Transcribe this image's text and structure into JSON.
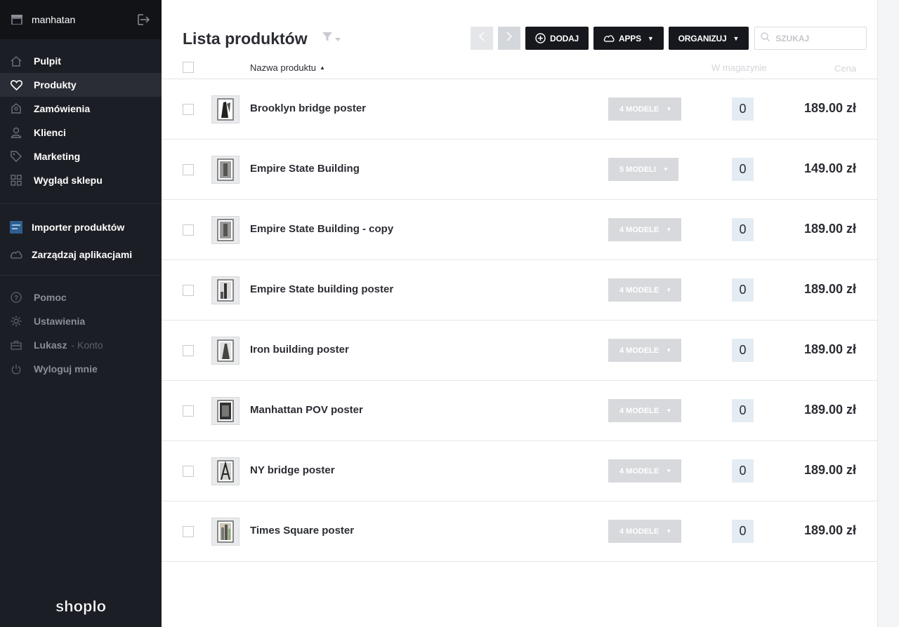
{
  "sidebar": {
    "store_name": "manhatan",
    "nav": [
      {
        "label": "Pulpit",
        "icon": "home-icon"
      },
      {
        "label": "Produkty",
        "icon": "heart-icon",
        "active": true
      },
      {
        "label": "Zamówienia",
        "icon": "inbox-icon"
      },
      {
        "label": "Klienci",
        "icon": "user-icon"
      },
      {
        "label": "Marketing",
        "icon": "tag-icon"
      },
      {
        "label": "Wygląd sklepu",
        "icon": "grid-icon"
      }
    ],
    "apps": [
      {
        "label": "Importer produktów",
        "icon": "importer-app-icon"
      },
      {
        "label": "Zarządzaj aplikacjami",
        "icon": "cloud-icon"
      }
    ],
    "bottom": [
      {
        "label": "Pomoc",
        "icon": "help-icon"
      },
      {
        "label": "Ustawienia",
        "icon": "gear-icon"
      },
      {
        "label": "Lukasz",
        "sub": "- Konto",
        "icon": "briefcase-icon"
      },
      {
        "label": "Wyloguj mnie",
        "icon": "power-icon"
      }
    ],
    "logo": "shoplo"
  },
  "page": {
    "title": "Lista produktów"
  },
  "toolbar": {
    "add_label": "DODAJ",
    "apps_label": "APPS",
    "organize_label": "ORGANIZUJ",
    "search_placeholder": "SZUKAJ"
  },
  "table": {
    "col_name": "Nazwa produktu",
    "col_stock": "W magazynie",
    "col_price": "Cena",
    "rows": [
      {
        "name": "Brooklyn bridge poster",
        "models": "4 MODELE",
        "stock": "0",
        "price": "189.00 zł"
      },
      {
        "name": "Empire State Building",
        "models": "5 MODELI",
        "stock": "0",
        "price": "149.00 zł"
      },
      {
        "name": "Empire State Building - copy",
        "models": "4 MODELE",
        "stock": "0",
        "price": "189.00 zł"
      },
      {
        "name": "Empire State building poster",
        "models": "4 MODELE",
        "stock": "0",
        "price": "189.00 zł"
      },
      {
        "name": "Iron building poster",
        "models": "4 MODELE",
        "stock": "0",
        "price": "189.00 zł"
      },
      {
        "name": "Manhattan POV poster",
        "models": "4 MODELE",
        "stock": "0",
        "price": "189.00 zł"
      },
      {
        "name": "NY bridge poster",
        "models": "4 MODELE",
        "stock": "0",
        "price": "189.00 zł"
      },
      {
        "name": "Times Square poster",
        "models": "4 MODELE",
        "stock": "0",
        "price": "189.00 zł"
      }
    ]
  },
  "colors": {
    "sidebar_bg": "#1c1e25",
    "sidebar_top_bg": "#111317",
    "button_dark": "#16181d",
    "models_btn": "#d7d9dc",
    "stock_badge": "#e3ecf2"
  }
}
